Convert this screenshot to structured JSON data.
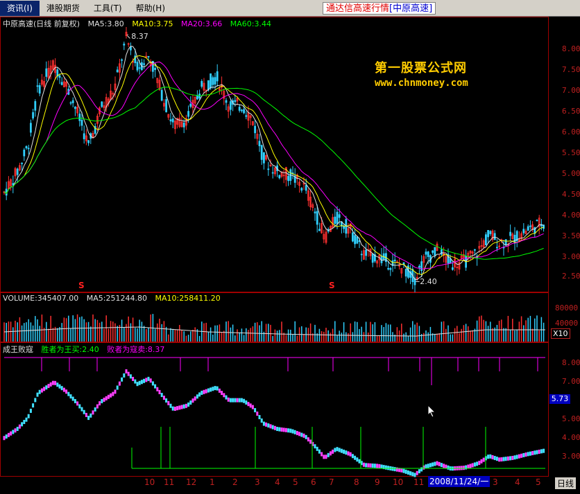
{
  "menu": {
    "items": [
      "资讯(I)",
      "港股期货",
      "工具(T)",
      "帮助(H)"
    ]
  },
  "title": {
    "main": "通达信高速行情",
    "sub": "[中原高速]"
  },
  "panel1": {
    "info": [
      {
        "text": "中原高速(日线 前复权)",
        "color": "#e0e0e0"
      },
      {
        "text": "MA5:3.80",
        "color": "#e0e0e0"
      },
      {
        "text": "MA10:3.75",
        "color": "#ffff00"
      },
      {
        "text": "MA20:3.66",
        "color": "#ff00ff"
      },
      {
        "text": "MA60:3.44",
        "color": "#00ff00"
      }
    ],
    "y_ticks": [
      "8.00",
      "7.50",
      "7.00",
      "6.50",
      "6.00",
      "5.50",
      "5.00",
      "4.50",
      "4.00",
      "3.50",
      "3.00",
      "2.50"
    ],
    "high_mark": "8.37",
    "low_mark": "2.40",
    "s_mark": "S"
  },
  "watermark": {
    "line1": "第一股票公式网",
    "line2": "www.chnmoney.com"
  },
  "panel2": {
    "info": [
      {
        "text": "VOLUME:345407.00",
        "color": "#e0e0e0"
      },
      {
        "text": "MA5:251244.80",
        "color": "#e0e0e0"
      },
      {
        "text": "MA10:258411.20",
        "color": "#ffff00"
      }
    ],
    "y_ticks": [
      "80000",
      "40000"
    ],
    "scale": "X10"
  },
  "panel3": {
    "info": [
      {
        "text": "成王败寇",
        "color": "#e0e0e0"
      },
      {
        "text": "胜者为王买:2.40",
        "color": "#00ff00"
      },
      {
        "text": "败者为寇卖:8.37",
        "color": "#ff00ff"
      }
    ],
    "y_ticks": [
      "8.00",
      "7.00",
      "5.00",
      "4.00",
      "3.00"
    ],
    "current_badge": "5.73"
  },
  "date_axis": {
    "ticks": [
      "10",
      "11",
      "12",
      "1",
      "2",
      "3",
      "4",
      "5",
      "6",
      "7",
      "8",
      "9",
      "10",
      "11",
      "2008/11/24/一",
      "3",
      "4",
      "5"
    ],
    "period": "日线"
  },
  "colors": {
    "up": "#ff3030",
    "down": "#30d0ff",
    "ma5": "#e0e0e0",
    "ma10": "#ffff00",
    "ma20": "#ff00ff",
    "ma60": "#00ff00",
    "frame": "#a00000"
  }
}
